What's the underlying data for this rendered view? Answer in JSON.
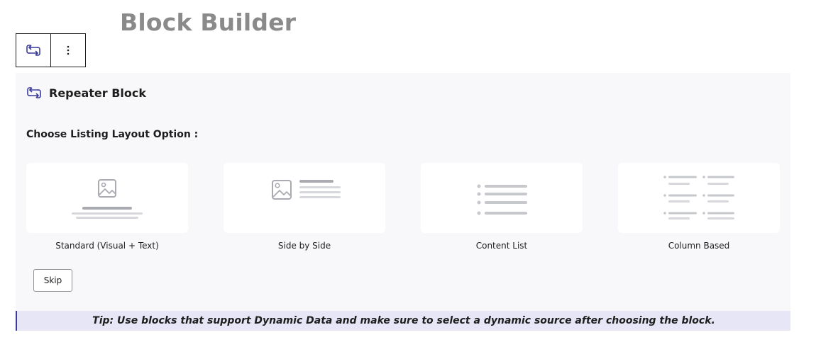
{
  "page": {
    "title": "Block Builder"
  },
  "toolbar": {
    "repeater_icon": "repeat-arrows-icon",
    "more_icon": "vertical-ellipsis-icon"
  },
  "panel": {
    "icon": "repeat-arrows-icon",
    "title": "Repeater Block",
    "choose_label": "Choose Listing Layout Option :",
    "layouts": [
      {
        "label": "Standard (Visual + Text)",
        "icon": "standard-layout-icon"
      },
      {
        "label": "Side by Side",
        "icon": "side-by-side-layout-icon"
      },
      {
        "label": "Content List",
        "icon": "content-list-layout-icon"
      },
      {
        "label": "Column Based",
        "icon": "column-based-layout-icon"
      }
    ],
    "skip_label": "Skip"
  },
  "tip": {
    "text": "Tip: Use blocks that support Dynamic Data and make sure to select a dynamic source after choosing the block."
  },
  "colors": {
    "accent": "#3b3b9e",
    "title_gray": "#8a8a8a",
    "panel_bg": "#f8f8fa",
    "tip_bg": "#e6e6f7",
    "placeholder_gray": "#c6c8cc"
  }
}
